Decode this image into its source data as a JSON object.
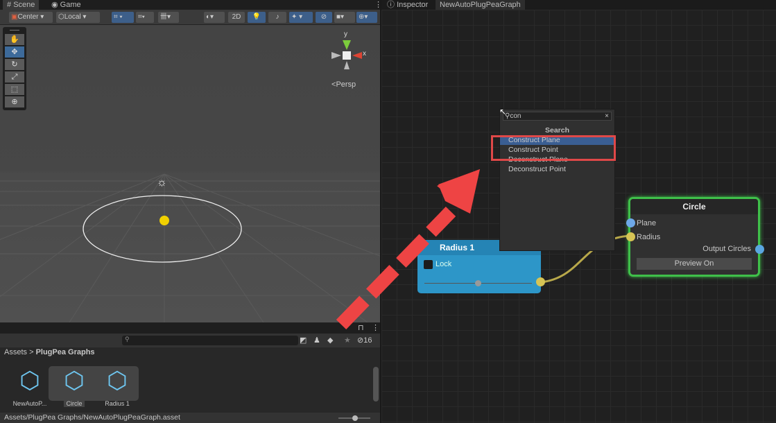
{
  "scene_tabs": [
    {
      "label": "Scene",
      "icon": "grid-icon"
    },
    {
      "label": "Game",
      "icon": "gamepad-icon"
    }
  ],
  "scene_toolbar": {
    "pivot": "Center",
    "space": "Local",
    "mode_2d": "2D"
  },
  "scene_view": {
    "projection": "Persp",
    "gizmo_axes": {
      "y": "y",
      "x": "x"
    }
  },
  "project": {
    "breadcrumb": [
      "Assets",
      "PlugPea Graphs"
    ],
    "hidden_count": "16",
    "search_value": "",
    "assets": [
      {
        "name": "NewAutoP..."
      },
      {
        "name": "Circle",
        "selected": true
      },
      {
        "name": "Radius 1"
      }
    ],
    "status_path": "Assets/PlugPea Graphs/NewAutoPlugPeaGraph.asset"
  },
  "right_tabs": [
    {
      "label": "Inspector",
      "icon": "info-icon"
    },
    {
      "label": "NewAutoPlugPeaGraph",
      "active": true
    }
  ],
  "search_popup": {
    "query": "con",
    "header": "Search",
    "items": [
      {
        "label": "Construct Plane",
        "selected": true
      },
      {
        "label": "Construct Point"
      },
      {
        "label": "Deconstruct Plane"
      },
      {
        "label": "Deconstruct Point"
      }
    ]
  },
  "radius_node": {
    "title": "Radius 1",
    "value": "0.50",
    "lock_label": "Lock",
    "slider_value": 0.5
  },
  "circle_node": {
    "title": "Circle",
    "inputs": [
      "Plane",
      "Radius"
    ],
    "output": "Output Circles",
    "button": "Preview On"
  },
  "colors": {
    "highlight_box": "#e04848",
    "annotation_arrow": "#ee4444",
    "node_selected": "#3fc04a",
    "float_port": "#d6c455",
    "vector_port": "#6ea8e8"
  }
}
